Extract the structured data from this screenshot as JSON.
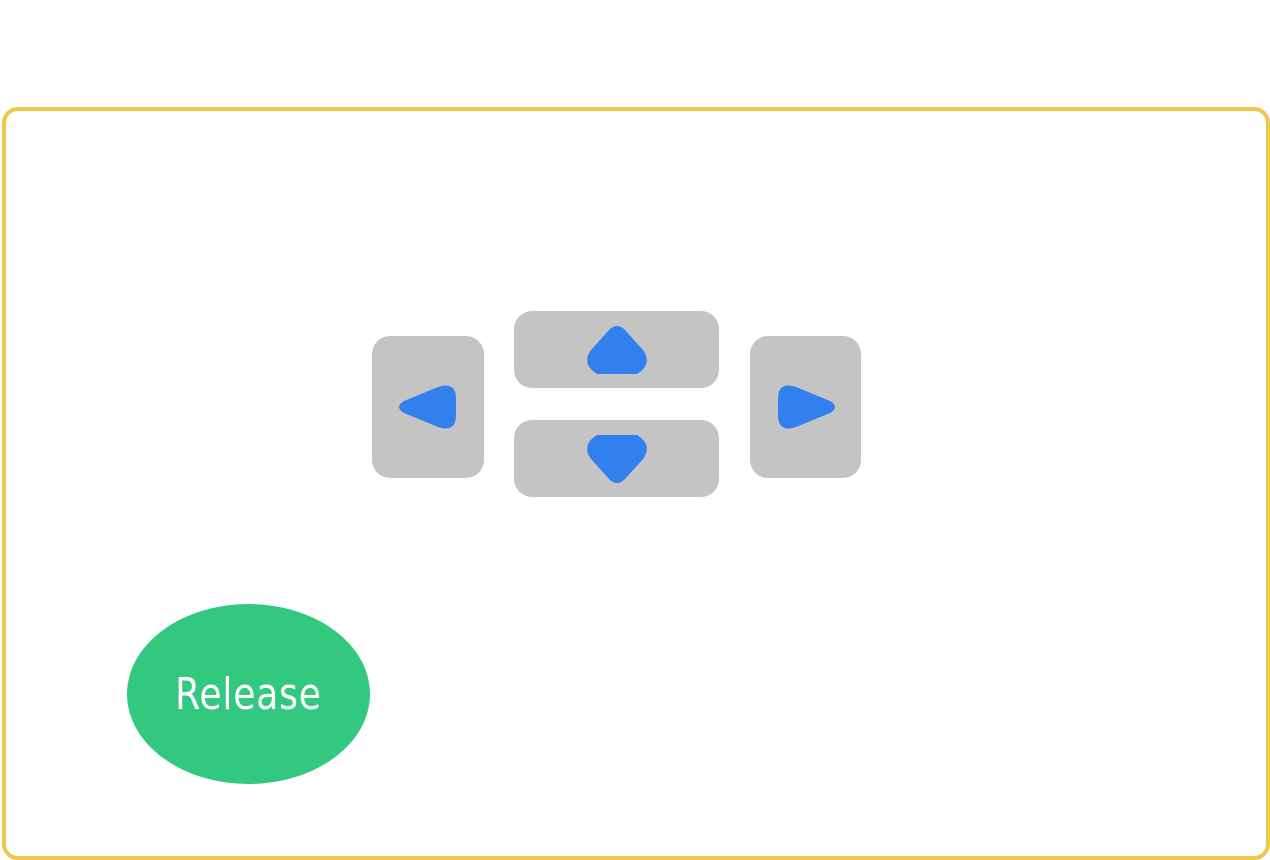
{
  "controls": {
    "move_left": {
      "icon": "triangle-left-icon"
    },
    "move_up": {
      "icon": "triangle-up-icon"
    },
    "move_down": {
      "icon": "triangle-down-icon"
    },
    "move_right": {
      "icon": "triangle-right-icon"
    },
    "release": {
      "label": "Release"
    }
  },
  "colors": {
    "panel_border": "#efc84f",
    "dpad_background": "#c4c4c5",
    "arrow": "#3280ee",
    "release_background": "#33c880",
    "release_text": "#ffffff"
  }
}
